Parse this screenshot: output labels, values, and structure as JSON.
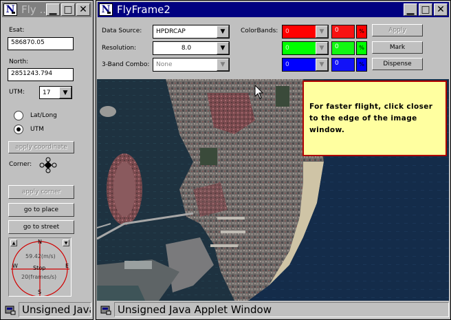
{
  "left_window": {
    "title": "Fly ...",
    "esat_label": "Esat:",
    "esat_value": "586870.05",
    "north_label": "North:",
    "north_value": "2851243.794",
    "utm_label": "UTM:",
    "utm_zone": "17",
    "radio_latlong": "Lat/Long",
    "radio_utm": "UTM",
    "selected_radio": "UTM",
    "apply_coordinate": "apply coordinate",
    "corner_label": "Corner:",
    "apply_corner": "apply corner",
    "go_to_place": "go to place",
    "go_to_street": "go to street",
    "compass": {
      "n": "N",
      "e": "E",
      "s": "S",
      "w": "W",
      "stop": "Stop",
      "speed": "59.42(m/s)",
      "fps": "20(frames/s)"
    },
    "status": "Unsigned Java Applet Window"
  },
  "main_window": {
    "title": "FlyFrame2",
    "data_source_label": "Data Source:",
    "data_source_value": "HPDRCAP",
    "resolution_label": "Resolution:",
    "resolution_value": "8.0",
    "three_band_label": "3-Band Combo:",
    "three_band_value": "None",
    "colorbands_label": "ColorBands:",
    "bands": [
      {
        "value": "0",
        "percent_value": "0",
        "percent_sign": "%",
        "color": "#ff0000"
      },
      {
        "value": "0",
        "percent_value": "0",
        "percent_sign": "%",
        "color": "#00ff00"
      },
      {
        "value": "0",
        "percent_value": "0",
        "percent_sign": "%",
        "color": "#0000ff"
      }
    ],
    "apply": "Apply",
    "mark": "Mark",
    "dispense": "Dispense",
    "tooltip": "For faster flight, click closer to the edge of the image window.",
    "status": "Unsigned Java Applet Window"
  },
  "colors": {
    "active_title": "#000080",
    "inactive_title": "#808080",
    "window_bg": "#c0c0c0",
    "note_bg": "#ffffa0",
    "note_border": "#b00000"
  }
}
